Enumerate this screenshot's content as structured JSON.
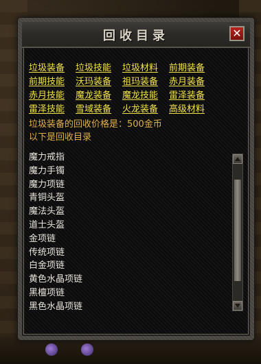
{
  "dialog": {
    "title": "回收目录",
    "close_glyph": "✕"
  },
  "links": [
    [
      "垃圾装备",
      "垃圾技能",
      "垃圾材料",
      "前期装备"
    ],
    [
      "前期技能",
      "沃玛装备",
      "祖玛装备",
      "赤月装备"
    ],
    [
      "赤月技能",
      "魔龙装备",
      "魔龙技能",
      "雷泽装备"
    ],
    [
      "雷泽技能",
      "雪域装备",
      "火龙装备",
      "高级材料"
    ]
  ],
  "info": {
    "price_line": "垃圾装备的回收价格是：500金币",
    "list_title": "以下是回收目录"
  },
  "items": [
    "魔力戒指",
    "魔力手镯",
    "魔力项链",
    "青铜头盔",
    "魔法头盔",
    "道士头盔",
    "金项链",
    "传统项链",
    "白金项链",
    "黄色水晶项链",
    "黑檀项链",
    "黑色水晶项链"
  ],
  "colors": {
    "link": "#f2e34a",
    "info": "#e0b04a",
    "item": "#e8e4dc",
    "close": "#b7231b"
  }
}
